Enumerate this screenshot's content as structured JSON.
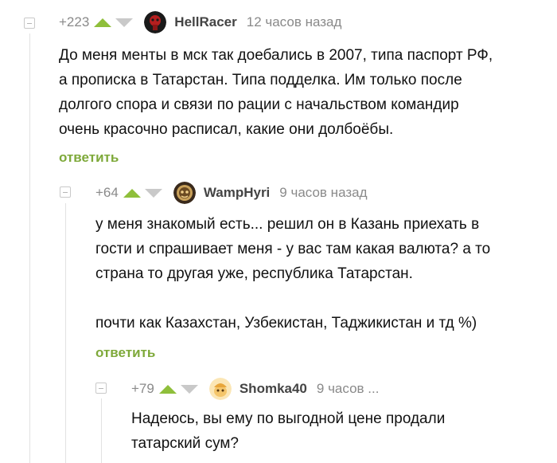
{
  "comments": [
    {
      "rating": "+223",
      "nick": "HellRacer",
      "time": "12 часов назад",
      "lines": [
        "До меня менты в мск так доебались в 2007, типа паспорт РФ,",
        "а прописка в Татарстан. Типа подделка. Им только после",
        "долгого спора и связи по рации с начальством командир",
        "очень красочно расписал, какие они долбоёбы."
      ],
      "reply": "ответить"
    },
    {
      "rating": "+64",
      "nick": "WampHyri",
      "time": "9 часов назад",
      "lines": [
        "у меня знакомый есть... решил он в Казань приехать в",
        "гости и спрашивает меня - у вас там какая валюта? а то",
        "страна то другая уже, республика Татарстан.",
        "",
        "почти как Казахстан, Узбекистан, Таджикистан и тд %)"
      ],
      "reply": "ответить"
    },
    {
      "rating": "+79",
      "nick": "Shomka40",
      "time": "9 часов ...",
      "lines": [
        "Надеюсь, вы ему по выгодной цене продали",
        "татарский сум?"
      ]
    }
  ],
  "icons": {
    "collapse": "minus-square-icon",
    "vote_up": "triangle-up-icon",
    "vote_down": "triangle-down-icon"
  },
  "colors": {
    "vote_up": "#8fbf3b",
    "vote_down": "#c9c9c9",
    "reply": "#7ea93a",
    "muted": "#8a8a8a"
  }
}
